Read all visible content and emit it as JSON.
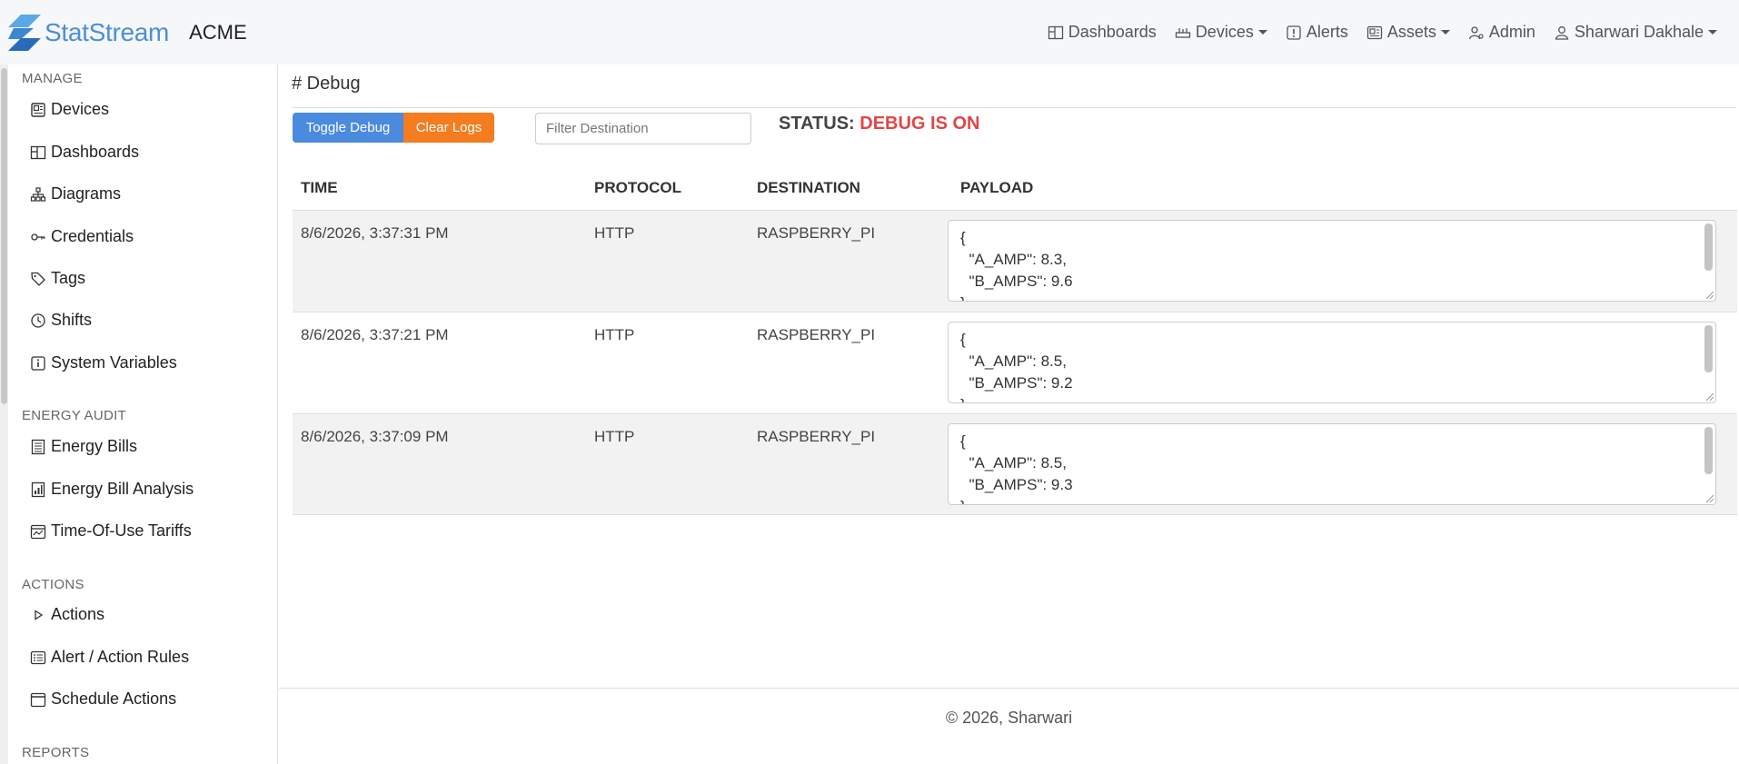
{
  "navbar": {
    "brand": "StatStream",
    "org": "ACME",
    "items": [
      {
        "label": "Dashboards",
        "icon": "dashboard-icon",
        "dropdown": false
      },
      {
        "label": "Devices",
        "icon": "devices-icon",
        "dropdown": true
      },
      {
        "label": "Alerts",
        "icon": "alert-icon",
        "dropdown": false
      },
      {
        "label": "Assets",
        "icon": "assets-icon",
        "dropdown": true
      },
      {
        "label": "Admin",
        "icon": "admin-icon",
        "dropdown": false
      },
      {
        "label": "Sharwari Dakhale",
        "icon": "user-icon",
        "dropdown": true
      }
    ]
  },
  "sidebar": {
    "manage_title": "MANAGE",
    "manage": [
      {
        "label": "Devices",
        "icon": "device-icon"
      },
      {
        "label": "Dashboards",
        "icon": "dashboard-icon"
      },
      {
        "label": "Diagrams",
        "icon": "diagram-icon"
      },
      {
        "label": "Credentials",
        "icon": "key-icon"
      },
      {
        "label": "Tags",
        "icon": "tag-icon"
      },
      {
        "label": "Shifts",
        "icon": "clock-icon"
      },
      {
        "label": "System Variables",
        "icon": "info-icon"
      }
    ],
    "energy_title": "ENERGY AUDIT",
    "energy": [
      {
        "label": "Energy Bills",
        "icon": "bill-icon"
      },
      {
        "label": "Energy Bill Analysis",
        "icon": "chart-icon"
      },
      {
        "label": "Time-Of-Use Tariffs",
        "icon": "calendar-chart-icon"
      }
    ],
    "actions_title": "ACTIONS",
    "actions": [
      {
        "label": "Actions",
        "icon": "play-icon"
      },
      {
        "label": "Alert / Action Rules",
        "icon": "rules-icon"
      },
      {
        "label": "Schedule Actions",
        "icon": "calendar-icon"
      }
    ],
    "reports_title": "REPORTS"
  },
  "main": {
    "title": "# Debug",
    "toggle_label": "Toggle Debug",
    "clear_label": "Clear Logs",
    "filter_placeholder": "Filter Destination",
    "status_label": "STATUS:",
    "status_value": "DEBUG IS ON",
    "status_color": "#e04646",
    "columns": [
      "TIME",
      "PROTOCOL",
      "DESTINATION",
      "PAYLOAD"
    ],
    "rows": [
      {
        "time": "8/6/2026, 3:37:31 PM",
        "protocol": "HTTP",
        "destination": "RASPBERRY_PI",
        "payload": "{\n  \"A_AMP\": 8.3,\n  \"B_AMPS\": 9.6\n}"
      },
      {
        "time": "8/6/2026, 3:37:21 PM",
        "protocol": "HTTP",
        "destination": "RASPBERRY_PI",
        "payload": "{\n  \"A_AMP\": 8.5,\n  \"B_AMPS\": 9.2\n}"
      },
      {
        "time": "8/6/2026, 3:37:09 PM",
        "protocol": "HTTP",
        "destination": "RASPBERRY_PI",
        "payload": "{\n  \"A_AMP\": 8.5,\n  \"B_AMPS\": 9.3\n}"
      }
    ]
  },
  "footer": {
    "text": "© 2026, Sharwari"
  },
  "colors": {
    "brand": "#4a8fd6",
    "toggle": "#4a8be0",
    "clear": "#f57c1f"
  }
}
